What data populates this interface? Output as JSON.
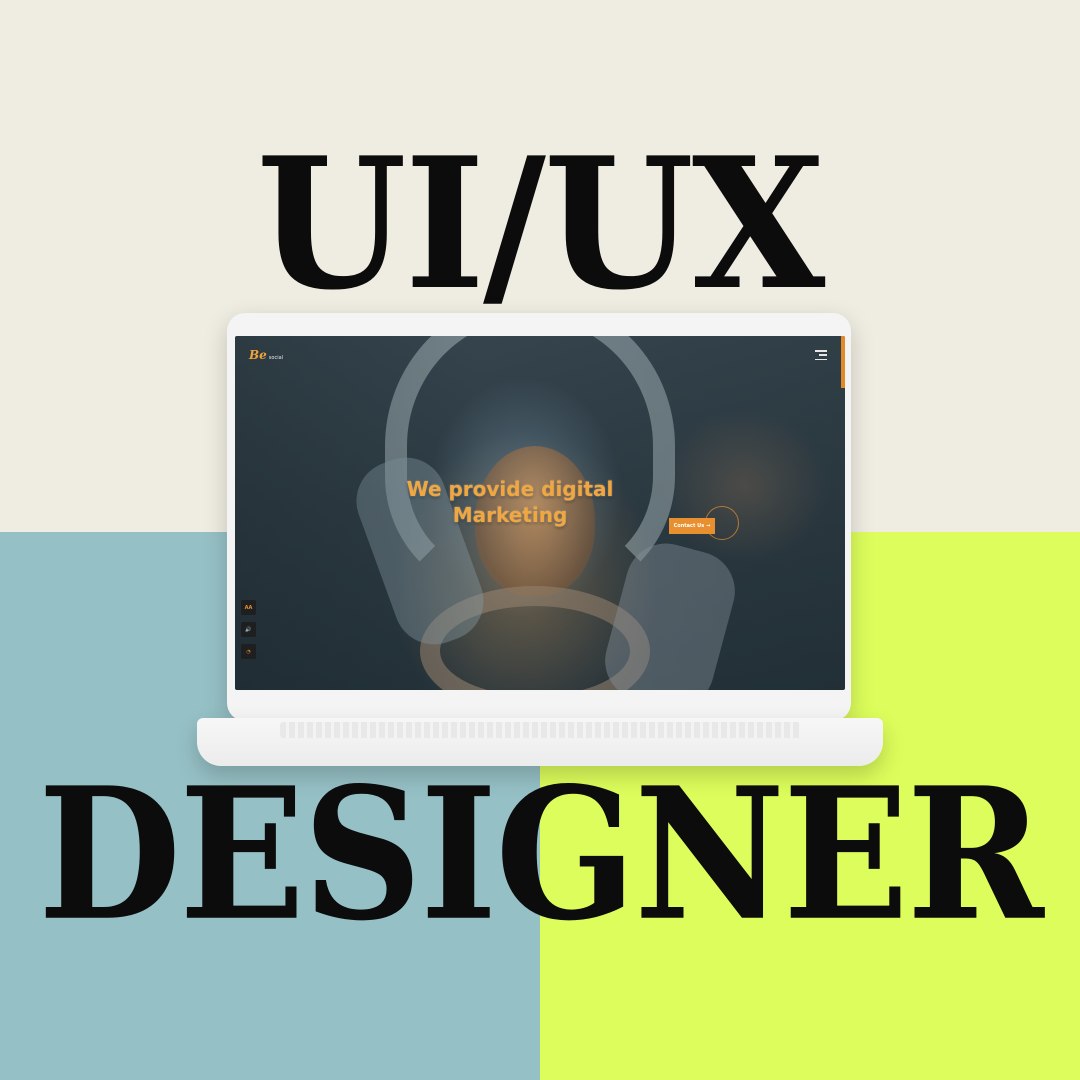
{
  "headline": {
    "top": "UI/UX",
    "bottom": "DESIGNER"
  },
  "colors": {
    "background_top": "#efece1",
    "background_bottom_left": "#95c0c5",
    "background_bottom_right": "#dcfd5b",
    "headline_text": "#0c0c0c",
    "accent_orange": "#e8902f"
  },
  "website": {
    "logo_mark": "Be",
    "logo_text": "social",
    "menu_icon": "hamburger-menu-icon",
    "hero_title_line1": "We provide digital",
    "hero_title_line2": "Marketing",
    "cta_label": "Contact Us",
    "cta_arrow": "→",
    "side_icons": [
      {
        "label": "AA",
        "icon": "font-size-icon"
      },
      {
        "label": "🔊",
        "icon": "audio-icon"
      },
      {
        "label": "◔",
        "icon": "whatsapp-icon"
      }
    ]
  }
}
